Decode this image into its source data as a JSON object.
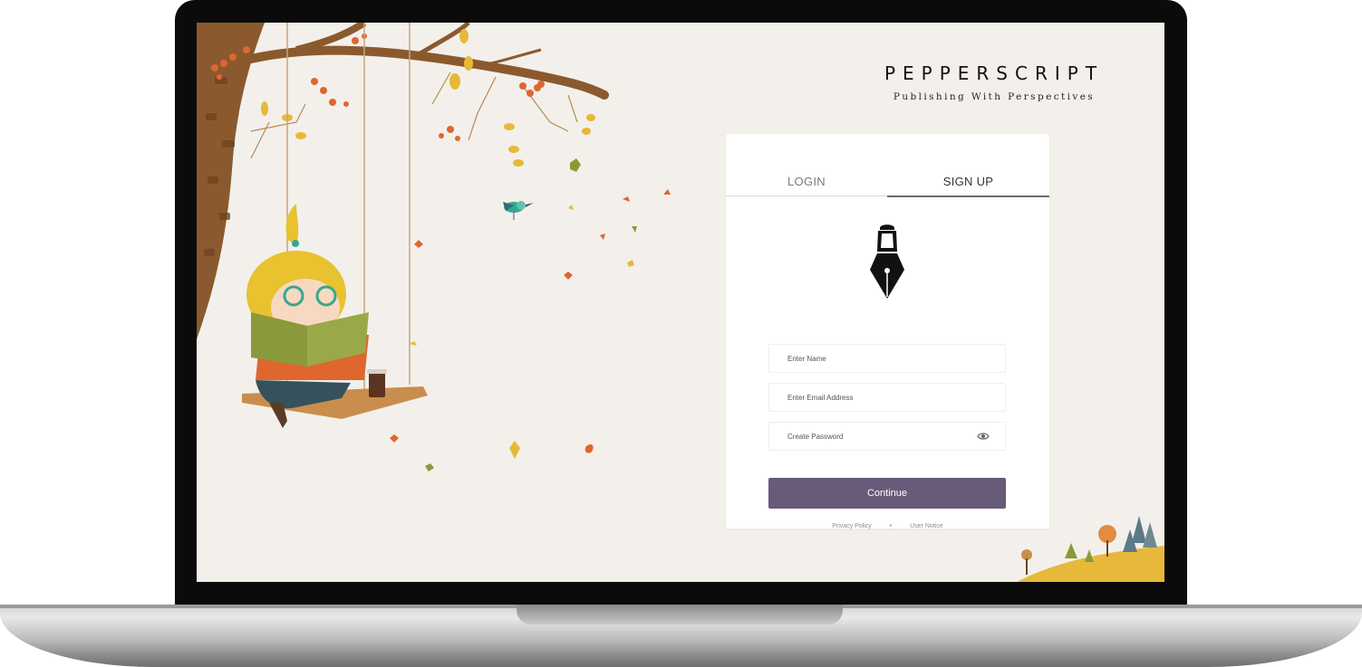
{
  "brand": {
    "title": "PEPPERSCRIPT",
    "tagline": "Publishing With Perspectives"
  },
  "tabs": [
    {
      "label": "LOGIN",
      "active": false
    },
    {
      "label": "SIGN UP",
      "active": true
    }
  ],
  "form": {
    "name_placeholder": "Enter Name",
    "email_placeholder": "Enter Email Address",
    "password_placeholder": "Create Password",
    "submit_label": "Continue"
  },
  "footer": {
    "privacy_label": "Privacy Policy",
    "separator": "•",
    "notice_label": "User Notice"
  },
  "colors": {
    "screen_background": "#f3f0eb",
    "button": "#685a79",
    "leaf_orange": "#e0662f",
    "leaf_yellow": "#e7b93a",
    "trunk": "#8a5a2e"
  },
  "icons": {
    "logo": "fountain-pen-nib-icon",
    "password_toggle": "eye-icon"
  }
}
